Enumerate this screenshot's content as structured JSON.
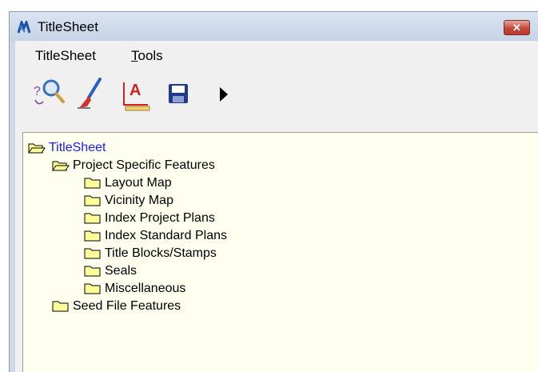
{
  "window": {
    "title": "TitleSheet",
    "close_label": "✕"
  },
  "menu": {
    "items": [
      {
        "prefix": "TitleSheet",
        "accel": "",
        "rest": ""
      },
      {
        "prefix": "",
        "accel": "T",
        "rest": "ools"
      }
    ]
  },
  "toolbar": {
    "tools": [
      "search-icon",
      "brush-icon",
      "text-annotation-icon",
      "save-icon",
      "play-arrow-icon"
    ]
  },
  "tree": {
    "root": "TitleSheet",
    "project": "Project Specific Features",
    "children": [
      "Layout Map",
      "Vicinity Map",
      "Index Project Plans",
      "Index Standard Plans",
      "Title Blocks/Stamps",
      "Seals",
      "Miscellaneous"
    ],
    "seed": "Seed File Features"
  },
  "colors": {
    "tree_bg": "#fffff0",
    "root_link": "#1a1aff",
    "folder": "#ffff99"
  }
}
